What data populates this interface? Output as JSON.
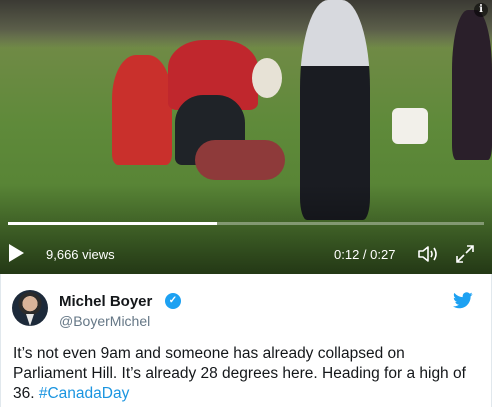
{
  "video": {
    "views": "9,666 views",
    "time": "0:12 / 0:27",
    "progress": 0.44,
    "info_label": "i"
  },
  "tweet": {
    "name": "Michel Boyer",
    "handle": "@BoyerMichel",
    "text": "It’s not even 9am and someone has already collapsed on Parliament Hill. It’s already 28 degrees here.  Heading for a high of 36. ",
    "hashtag": "#CanadaDay",
    "verified_symbol": "✓"
  },
  "colors": {
    "link": "#1b95e0",
    "verified": "#1da1f2",
    "handle": "#657786"
  },
  "icons": [
    "play-icon",
    "volume-icon",
    "fullscreen-icon",
    "info-icon",
    "verified-icon",
    "twitter-bird-icon"
  ]
}
